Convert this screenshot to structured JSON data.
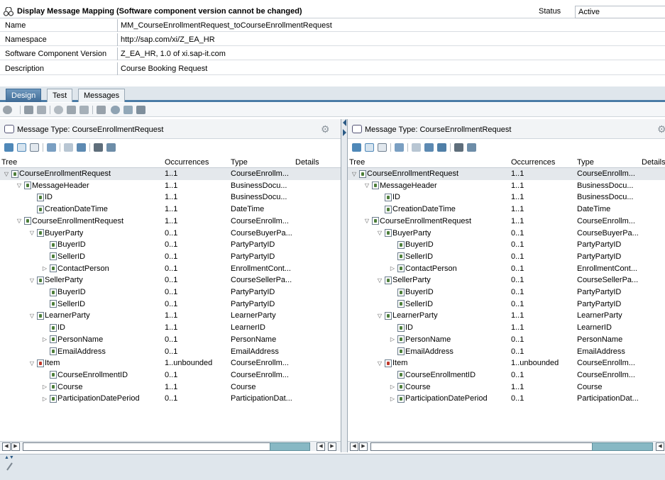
{
  "header": {
    "title": "Display Message Mapping (Software component version cannot be changed)",
    "status_label": "Status",
    "status_value": "Active",
    "fields": [
      {
        "label": "Name",
        "value": "MM_CourseEnrollmentRequest_toCourseEnrollmentRequest"
      },
      {
        "label": "Namespace",
        "value": "http://sap.com/xi/Z_EA_HR"
      },
      {
        "label": "Software Component Version",
        "value": "Z_EA_HR, 1.0 of xi.sap-it.com"
      },
      {
        "label": "Description",
        "value": "Course Booking Request"
      }
    ]
  },
  "tabs": [
    {
      "label": "Design",
      "active": true
    },
    {
      "label": "Test",
      "active": false
    },
    {
      "label": "Messages",
      "active": false
    }
  ],
  "source_pane": {
    "message_type": "Message Type: CourseEnrollmentRequest",
    "columns": [
      "Tree",
      "Occurrences",
      "Type",
      "Details"
    ]
  },
  "target_pane": {
    "message_type": "Message Type: CourseEnrollmentRequest",
    "columns": [
      "Tree",
      "Occurrences",
      "Type",
      "Details"
    ]
  },
  "tree_rows": [
    {
      "name": "CourseEnrollmentRequest",
      "depth": 0,
      "toggle": "open",
      "occ": "1..1",
      "type": "CourseEnrollm...",
      "selected": true
    },
    {
      "name": "MessageHeader",
      "depth": 1,
      "toggle": "open",
      "occ": "1..1",
      "type": "BusinessDocu..."
    },
    {
      "name": "ID",
      "depth": 2,
      "toggle": "",
      "occ": "1..1",
      "type": "BusinessDocu..."
    },
    {
      "name": "CreationDateTime",
      "depth": 2,
      "toggle": "",
      "occ": "1..1",
      "type": "DateTime"
    },
    {
      "name": "CourseEnrollmentRequest",
      "depth": 1,
      "toggle": "open",
      "occ": "1..1",
      "type": "CourseEnrollm..."
    },
    {
      "name": "BuyerParty",
      "depth": 2,
      "toggle": "open",
      "occ": "0..1",
      "type": "CourseBuyerPa..."
    },
    {
      "name": "BuyerID",
      "depth": 3,
      "toggle": "",
      "occ": "0..1",
      "type": "PartyPartyID"
    },
    {
      "name": "SellerID",
      "depth": 3,
      "toggle": "",
      "occ": "0..1",
      "type": "PartyPartyID"
    },
    {
      "name": "ContactPerson",
      "depth": 3,
      "toggle": "closed",
      "occ": "0..1",
      "type": "EnrollmentCont..."
    },
    {
      "name": "SellerParty",
      "depth": 2,
      "toggle": "open",
      "occ": "0..1",
      "type": "CourseSellerPa..."
    },
    {
      "name": "BuyerID",
      "depth": 3,
      "toggle": "",
      "occ": "0..1",
      "type": "PartyPartyID"
    },
    {
      "name": "SellerID",
      "depth": 3,
      "toggle": "",
      "occ": "0..1",
      "type": "PartyPartyID"
    },
    {
      "name": "LearnerParty",
      "depth": 2,
      "toggle": "open",
      "occ": "1..1",
      "type": "LearnerParty"
    },
    {
      "name": "ID",
      "depth": 3,
      "toggle": "",
      "occ": "1..1",
      "type": "LearnerID"
    },
    {
      "name": "PersonName",
      "depth": 3,
      "toggle": "closed",
      "occ": "0..1",
      "type": "PersonName"
    },
    {
      "name": "EmailAddress",
      "depth": 3,
      "toggle": "",
      "occ": "0..1",
      "type": "EmailAddress"
    },
    {
      "name": "Item",
      "depth": 2,
      "toggle": "open",
      "occ": "1..unbounded",
      "type": "CourseEnrollm...",
      "red": true
    },
    {
      "name": "CourseEnrollmentID",
      "depth": 3,
      "toggle": "",
      "occ": "0..1",
      "type": "CourseEnrollm..."
    },
    {
      "name": "Course",
      "depth": 3,
      "toggle": "closed",
      "occ": "1..1",
      "type": "Course"
    },
    {
      "name": "ParticipationDatePeriod",
      "depth": 3,
      "toggle": "closed",
      "occ": "0..1",
      "type": "ParticipationDat..."
    }
  ]
}
